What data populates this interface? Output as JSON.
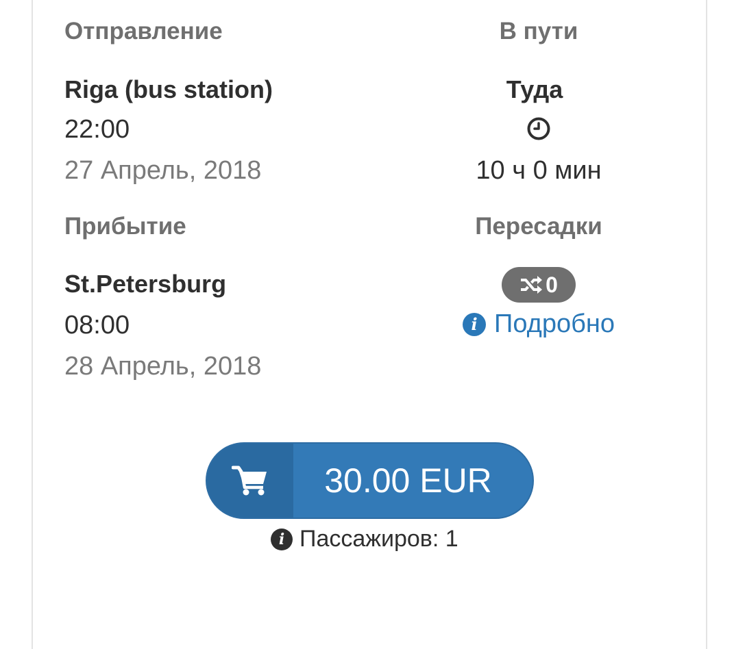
{
  "departure": {
    "heading": "Отправление",
    "city": "Riga (bus station)",
    "time": "22:00",
    "date": "27 Апрель, 2018"
  },
  "arrival": {
    "heading": "Прибытие",
    "city": "St.Petersburg",
    "time": "08:00",
    "date": "28 Апрель, 2018"
  },
  "travel": {
    "heading": "В пути",
    "direction": "Туда",
    "duration": "10 ч 0 мин",
    "icon": "clock-icon"
  },
  "transfers": {
    "heading": "Пересадки",
    "count": "0",
    "icon": "shuffle-icon",
    "details_label": "Подробно"
  },
  "purchase": {
    "price": "30.00 EUR",
    "icon": "cart-icon",
    "passengers_label": "Пассажиров: 1"
  },
  "colors": {
    "accent": "#337ab7",
    "accent_dark": "#2a6aa1",
    "link": "#2a78b8",
    "badge": "#6f6f6f",
    "muted_text": "#7a7a7a"
  }
}
